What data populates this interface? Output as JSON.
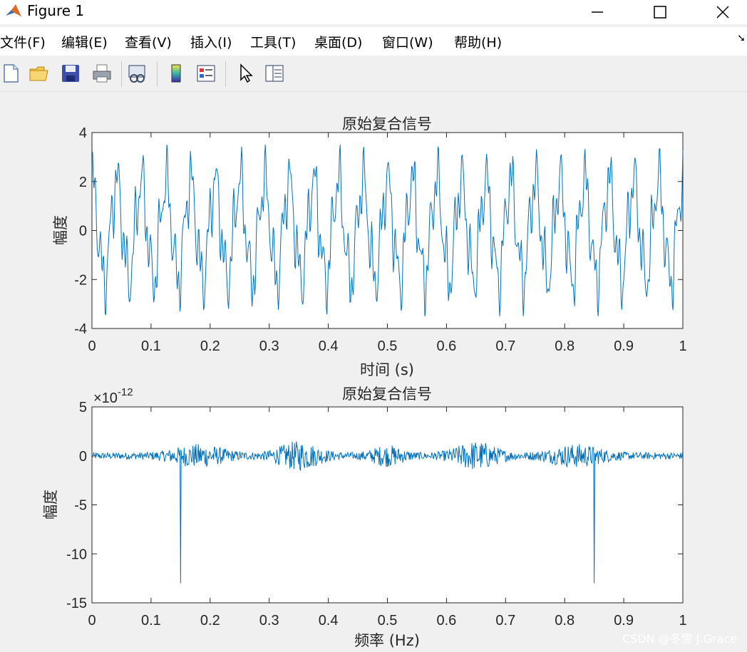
{
  "window": {
    "title": "Figure 1",
    "controls": [
      "minimize",
      "maximize",
      "close"
    ]
  },
  "menu": [
    "文件(F)",
    "编辑(E)",
    "查看(V)",
    "插入(I)",
    "工具(T)",
    "桌面(D)",
    "窗口(W)",
    "帮助(H)"
  ],
  "toolbar": [
    "new-figure-icon",
    "open-folder-icon",
    "save-icon",
    "print-icon",
    "link-plot-icon",
    "colorbar-icon",
    "legend-icon",
    "edit-plot-arrow-icon",
    "property-inspector-icon"
  ],
  "watermark": "CSDN @冬雪 J.Grace",
  "colors": {
    "line": "#0072bd",
    "figure_bg": "#f0f0f0",
    "axes_bg": "#ffffff"
  },
  "chart_data": [
    {
      "type": "line",
      "title": "原始复合信号",
      "xlabel": "时间 (s)",
      "ylabel": "幅度",
      "xlim": [
        0,
        1
      ],
      "ylim": [
        -4,
        4
      ],
      "xticks": [
        "0",
        "0.1",
        "0.2",
        "0.3",
        "0.4",
        "0.5",
        "0.6",
        "0.7",
        "0.8",
        "0.9",
        "1"
      ],
      "yticks": [
        "-4",
        "-2",
        "0",
        "2",
        "4"
      ],
      "signal": "composite periodic waveform, amplitude range about -3.5 to 3.5, repeating peaks roughly every 0.04 s",
      "series": [
        {
          "name": "",
          "x_range": [
            0,
            1
          ],
          "y_range": [
            -3.5,
            3.5
          ]
        }
      ]
    },
    {
      "type": "line",
      "title": "原始复合信号",
      "xlabel": "频率 (Hz)",
      "ylabel": "幅度",
      "exponent_label": "×10",
      "exponent_power": "-12",
      "xlim": [
        0,
        1
      ],
      "ylim": [
        -15,
        5
      ],
      "xticks": [
        "0",
        "0.1",
        "0.2",
        "0.3",
        "0.4",
        "0.5",
        "0.6",
        "0.7",
        "0.8",
        "0.9",
        "1"
      ],
      "yticks": [
        "-15",
        "-10",
        "-5",
        "0",
        "5"
      ],
      "noise_range": [
        -3,
        2.3
      ],
      "spikes": [
        {
          "x": 0.15,
          "y": -13
        },
        {
          "x": 0.85,
          "y": -13
        }
      ],
      "series": [
        {
          "name": ""
        }
      ]
    }
  ]
}
